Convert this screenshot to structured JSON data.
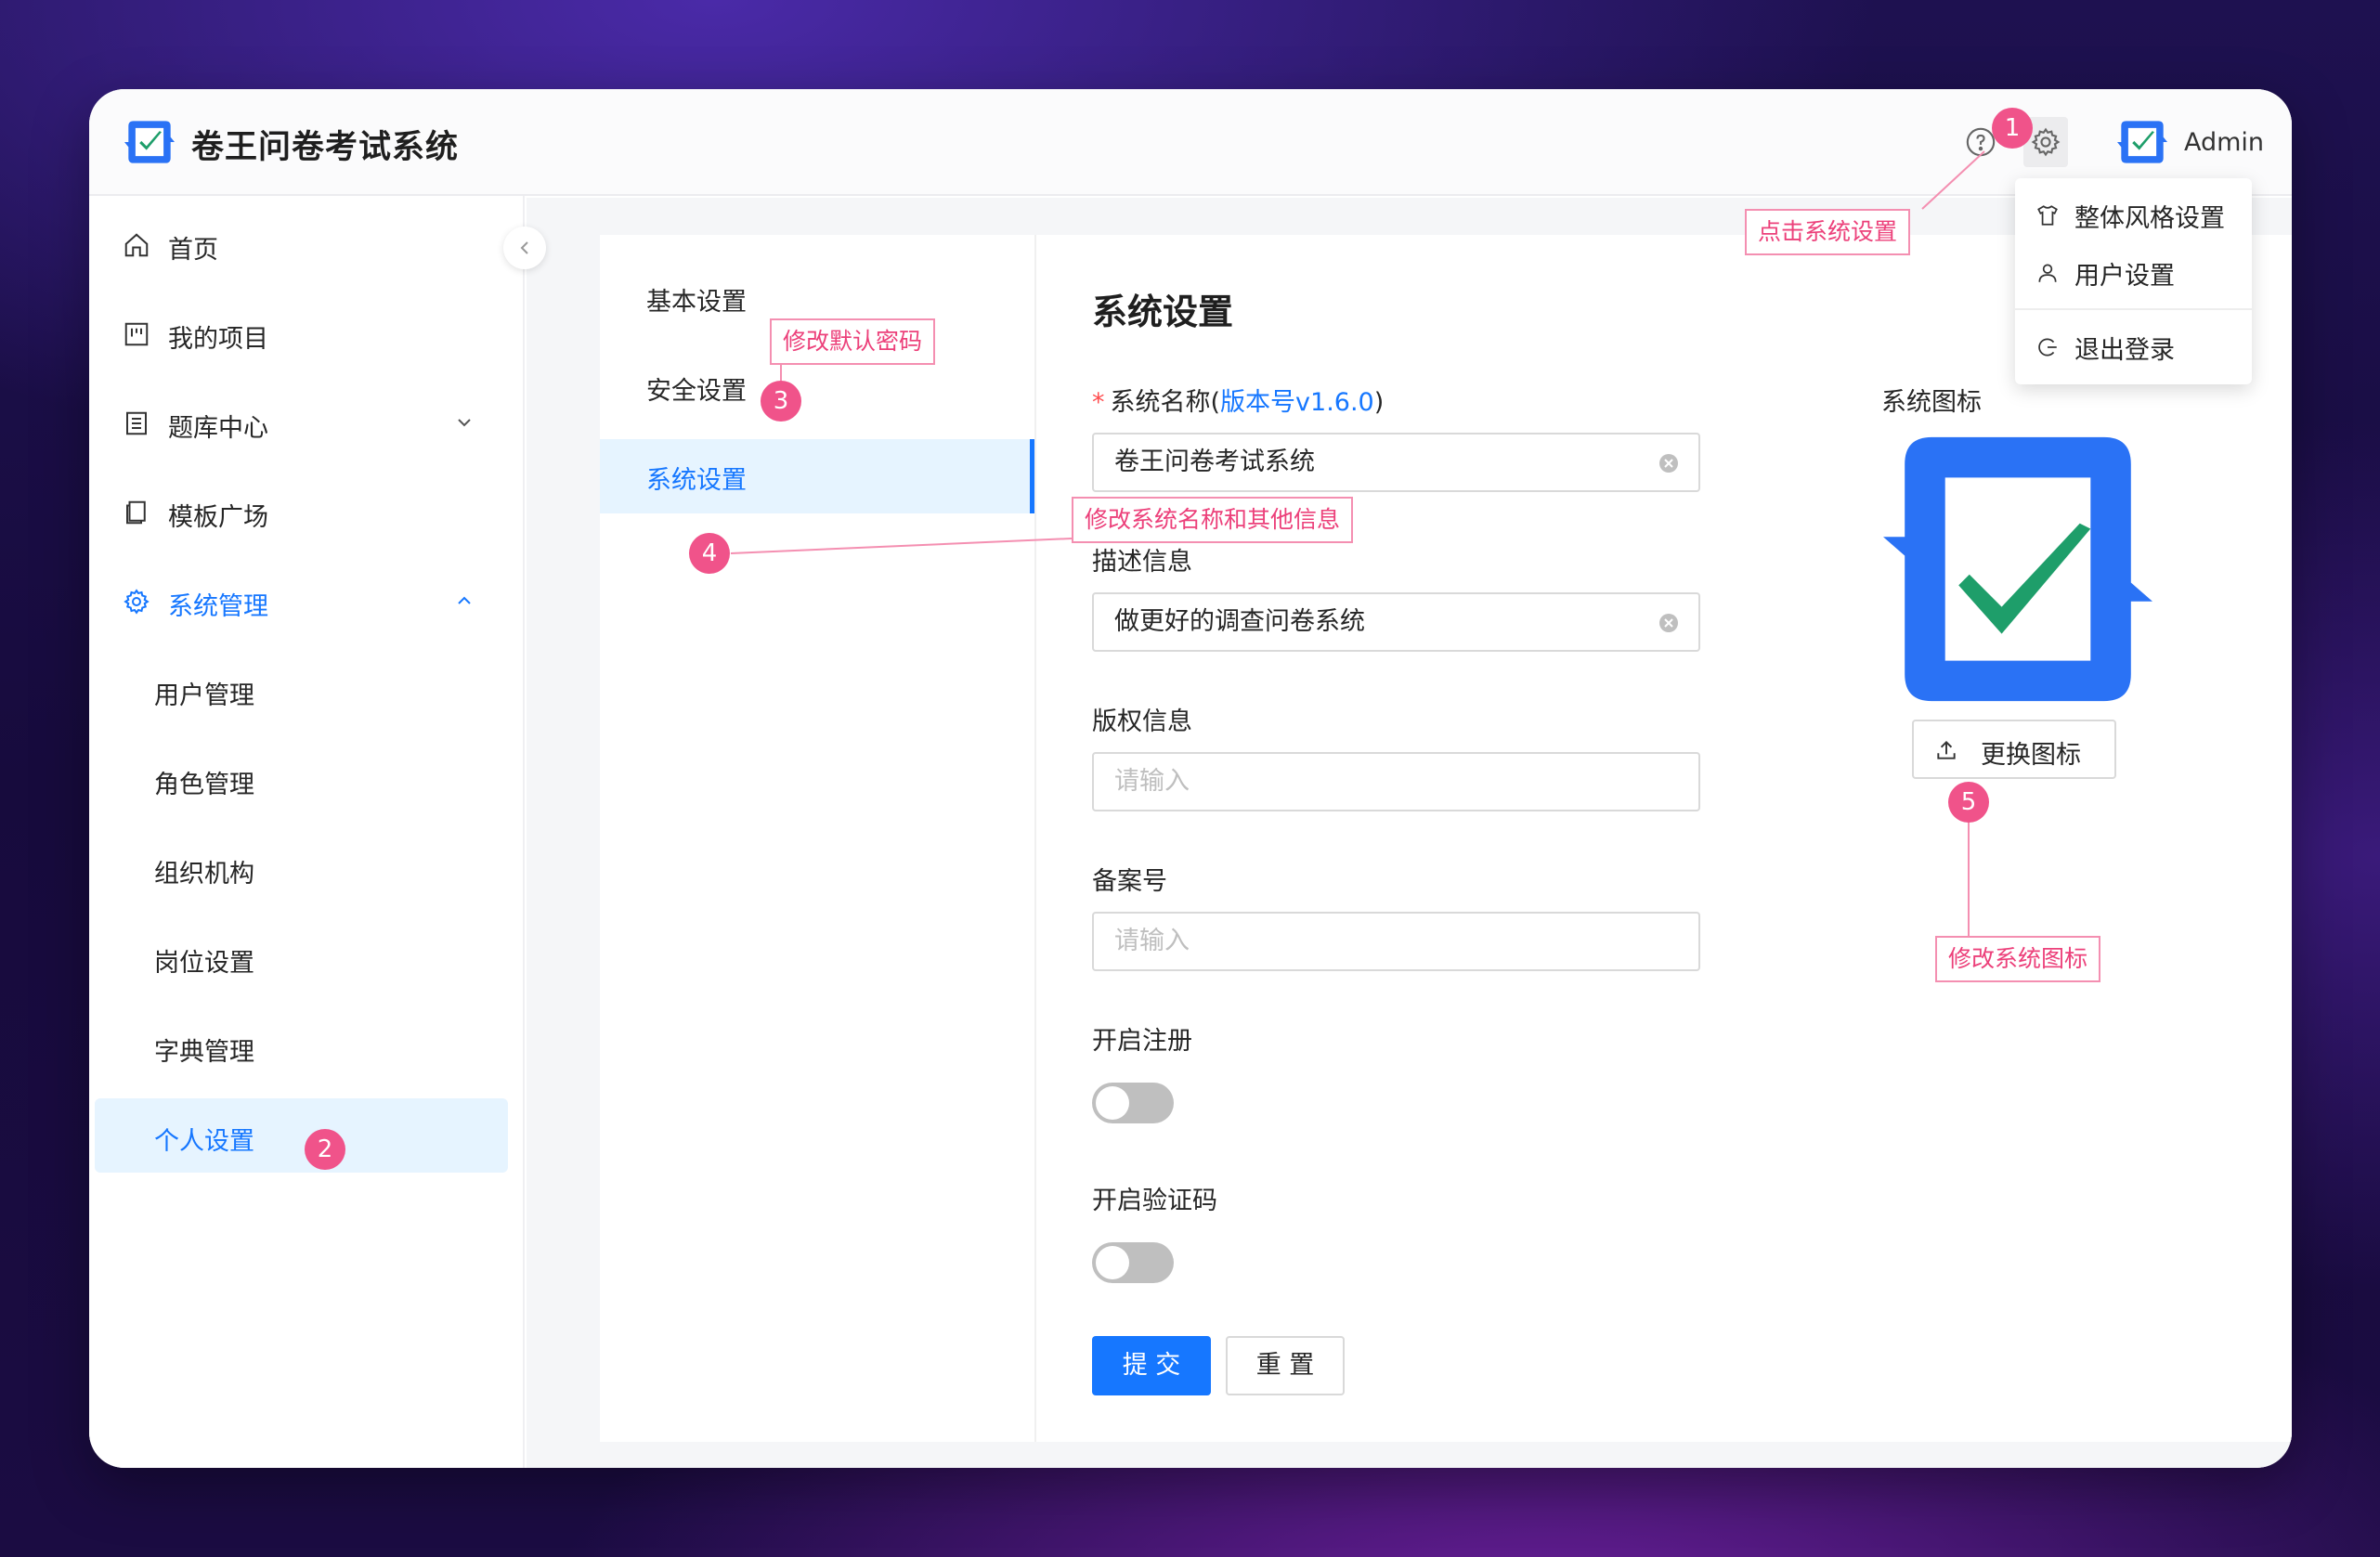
{
  "app": {
    "title": "卷王问卷考试系统",
    "username": "Admin"
  },
  "colors": {
    "primary": "#1677ff",
    "annotation": "#f0538a",
    "logo_blue": "#2a72f5",
    "logo_check": "#1e9e6a"
  },
  "header": {
    "icons": [
      "help-circle-icon",
      "gear-icon"
    ]
  },
  "dropdown": {
    "items": [
      {
        "label": "整体风格设置",
        "icon": "shirt-icon"
      },
      {
        "label": "用户设置",
        "icon": "user-icon"
      },
      {
        "label": "退出登录",
        "icon": "logout-icon"
      }
    ]
  },
  "sidebar": {
    "items": [
      {
        "label": "首页",
        "icon": "home-icon"
      },
      {
        "label": "我的项目",
        "icon": "project-icon"
      },
      {
        "label": "题库中心",
        "icon": "book-icon"
      },
      {
        "label": "模板广场",
        "icon": "template-icon"
      },
      {
        "label": "系统管理",
        "icon": "gear-icon"
      }
    ],
    "sub_items": [
      "用户管理",
      "角色管理",
      "组织机构",
      "岗位设置",
      "字典管理",
      "个人设置"
    ]
  },
  "settings_tabs": [
    "基本设置",
    "安全设置",
    "系统设置"
  ],
  "form": {
    "title": "系统设置",
    "system_name_label": "系统名称(",
    "version": "版本号v1.6.0",
    "system_name_suffix": ")",
    "system_name_value": "卷王问卷考试系统",
    "desc_label": "描述信息",
    "desc_value": "做更好的调查问卷系统",
    "copyright_label": "版权信息",
    "copyright_placeholder": "请输入",
    "icp_label": "备案号",
    "icp_placeholder": "请输入",
    "register_label": "开启注册",
    "register_enabled": false,
    "captcha_label": "开启验证码",
    "captcha_enabled": false,
    "submit_label": "提 交",
    "reset_label": "重 置"
  },
  "icon_panel": {
    "label": "系统图标",
    "change_label": "更换图标"
  },
  "annotations": [
    {
      "num": "1",
      "text": "点击系统设置"
    },
    {
      "num": "2",
      "text": ""
    },
    {
      "num": "3",
      "text": "修改默认密码"
    },
    {
      "num": "4",
      "text": "修改系统名称和其他信息"
    },
    {
      "num": "5",
      "text": "修改系统图标"
    }
  ]
}
